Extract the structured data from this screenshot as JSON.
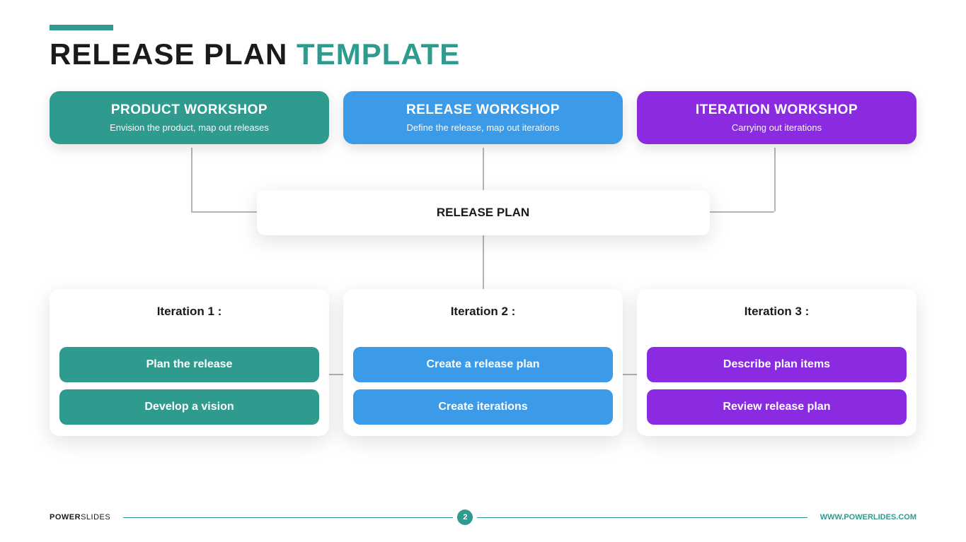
{
  "title": {
    "part1": "RELEASE PLAN ",
    "part2": "TEMPLATE"
  },
  "workshops": [
    {
      "title": "PRODUCT  WORKSHOP",
      "sub": "Envision the product, map out releases"
    },
    {
      "title": "RELEASE WORKSHOP",
      "sub": "Define the release, map out iterations"
    },
    {
      "title": "ITERATION WORKSHOP",
      "sub": "Carrying out iterations"
    }
  ],
  "release_plan_label": "RELEASE PLAN",
  "iterations": [
    {
      "title": "Iteration 1 :",
      "items": [
        "Plan the release",
        "Develop a vision"
      ]
    },
    {
      "title": "Iteration 2 :",
      "items": [
        "Create a release plan",
        "Create iterations"
      ]
    },
    {
      "title": "Iteration 3 :",
      "items": [
        "Describe plan items",
        "Review release plan"
      ]
    }
  ],
  "footer": {
    "brand1": "POWER",
    "brand2": "SLIDES",
    "page": "2",
    "url": "WWW.POWERLIDES.COM"
  },
  "colors": {
    "teal": "#2f9b8f",
    "blue": "#3b9be8",
    "purple": "#8a2be2"
  }
}
